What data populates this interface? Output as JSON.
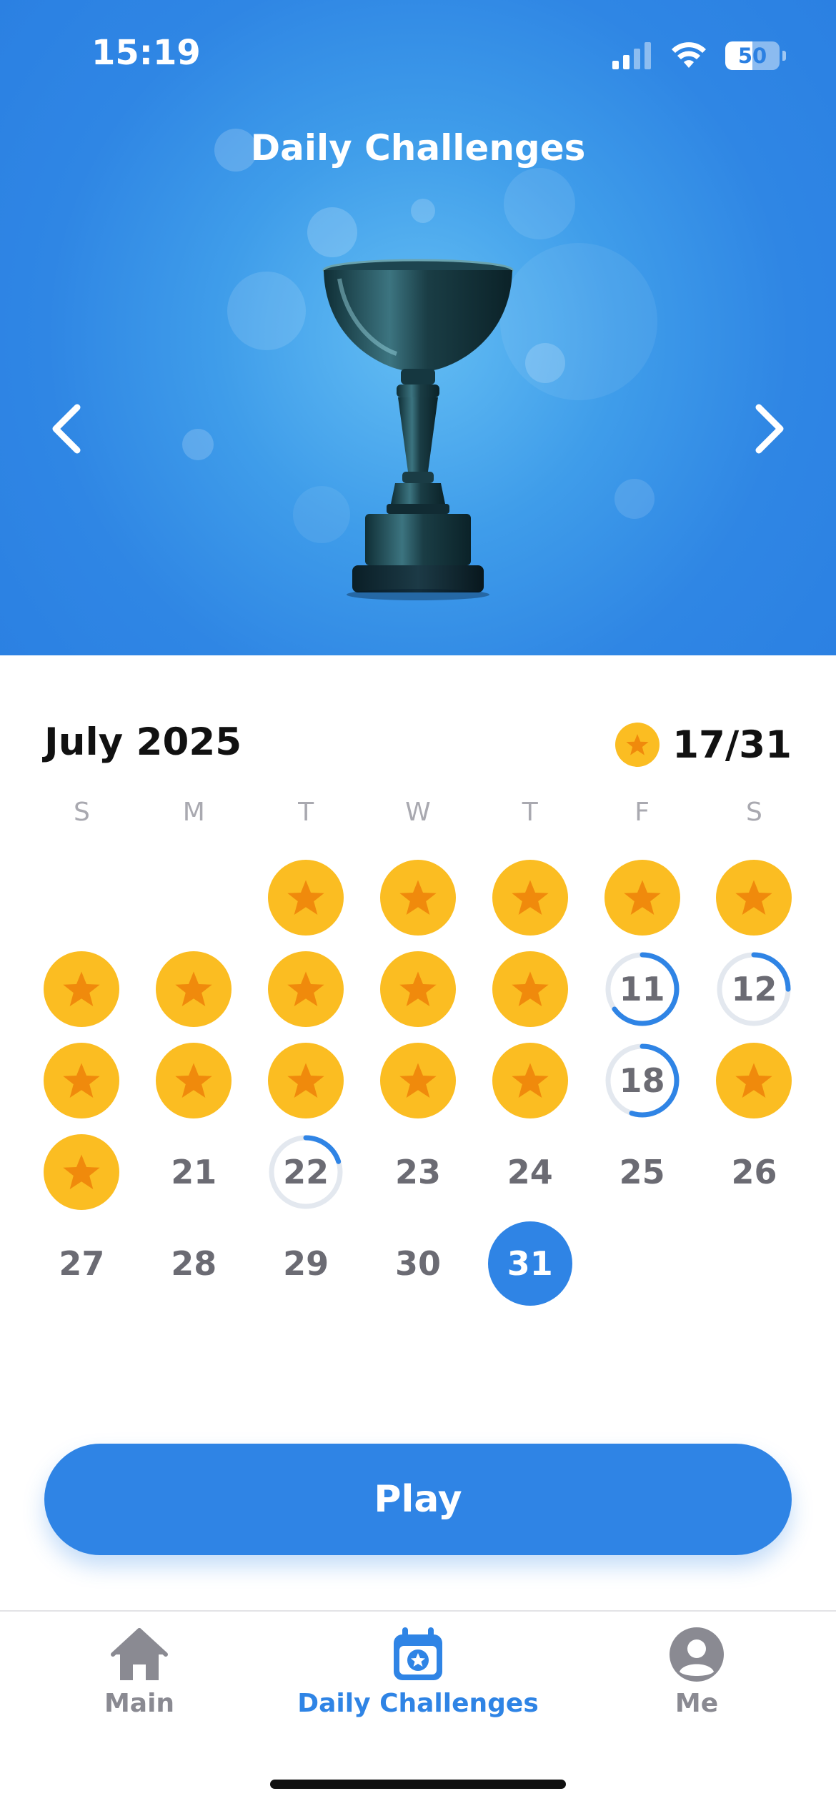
{
  "status_bar": {
    "time": "15:19",
    "battery": "50",
    "battery_level": 0.5
  },
  "hero": {
    "title": "Daily Challenges"
  },
  "calendar": {
    "month": "July 2025",
    "progress": "17/31",
    "weekdays": [
      "S",
      "M",
      "T",
      "W",
      "T",
      "F",
      "S"
    ],
    "day_labels": {
      "d11": "11",
      "d12": "12",
      "d18": "18",
      "d21": "21",
      "d22": "22",
      "d23": "23",
      "d24": "24",
      "d25": "25",
      "d26": "26",
      "d27": "27",
      "d28": "28",
      "d29": "29",
      "d30": "30",
      "d31": "31"
    },
    "days": [
      {
        "day": 1,
        "state": "completed"
      },
      {
        "day": 2,
        "state": "completed"
      },
      {
        "day": 3,
        "state": "completed"
      },
      {
        "day": 4,
        "state": "completed"
      },
      {
        "day": 5,
        "state": "completed"
      },
      {
        "day": 6,
        "state": "completed"
      },
      {
        "day": 7,
        "state": "completed"
      },
      {
        "day": 8,
        "state": "completed"
      },
      {
        "day": 9,
        "state": "completed"
      },
      {
        "day": 10,
        "state": "completed"
      },
      {
        "day": 11,
        "state": "partial",
        "progress": 0.65
      },
      {
        "day": 12,
        "state": "partial",
        "progress": 0.25
      },
      {
        "day": 13,
        "state": "completed"
      },
      {
        "day": 14,
        "state": "completed"
      },
      {
        "day": 15,
        "state": "completed"
      },
      {
        "day": 16,
        "state": "completed"
      },
      {
        "day": 17,
        "state": "completed"
      },
      {
        "day": 18,
        "state": "partial",
        "progress": 0.55
      },
      {
        "day": 19,
        "state": "completed"
      },
      {
        "day": 20,
        "state": "completed"
      },
      {
        "day": 21,
        "state": "none"
      },
      {
        "day": 22,
        "state": "partial",
        "progress": 0.2
      },
      {
        "day": 23,
        "state": "none"
      },
      {
        "day": 24,
        "state": "none"
      },
      {
        "day": 25,
        "state": "none"
      },
      {
        "day": 26,
        "state": "none"
      },
      {
        "day": 27,
        "state": "none"
      },
      {
        "day": 28,
        "state": "none"
      },
      {
        "day": 29,
        "state": "none"
      },
      {
        "day": 30,
        "state": "none"
      },
      {
        "day": 31,
        "state": "today"
      }
    ]
  },
  "play_button": {
    "label": "Play"
  },
  "tabbar": {
    "items": [
      {
        "label": "Main",
        "icon": "home-icon",
        "active": false
      },
      {
        "label": "Daily Challenges",
        "icon": "calendar-star-icon",
        "active": true
      },
      {
        "label": "Me",
        "icon": "person-icon",
        "active": false
      }
    ]
  },
  "colors": {
    "accent": "#2f84e5",
    "coin": "#fbbd22",
    "star": "#f08a0c",
    "muted_text": "#6b6b73",
    "inactive_tab": "#8a8a92",
    "ring_track": "#e3e8ef"
  }
}
